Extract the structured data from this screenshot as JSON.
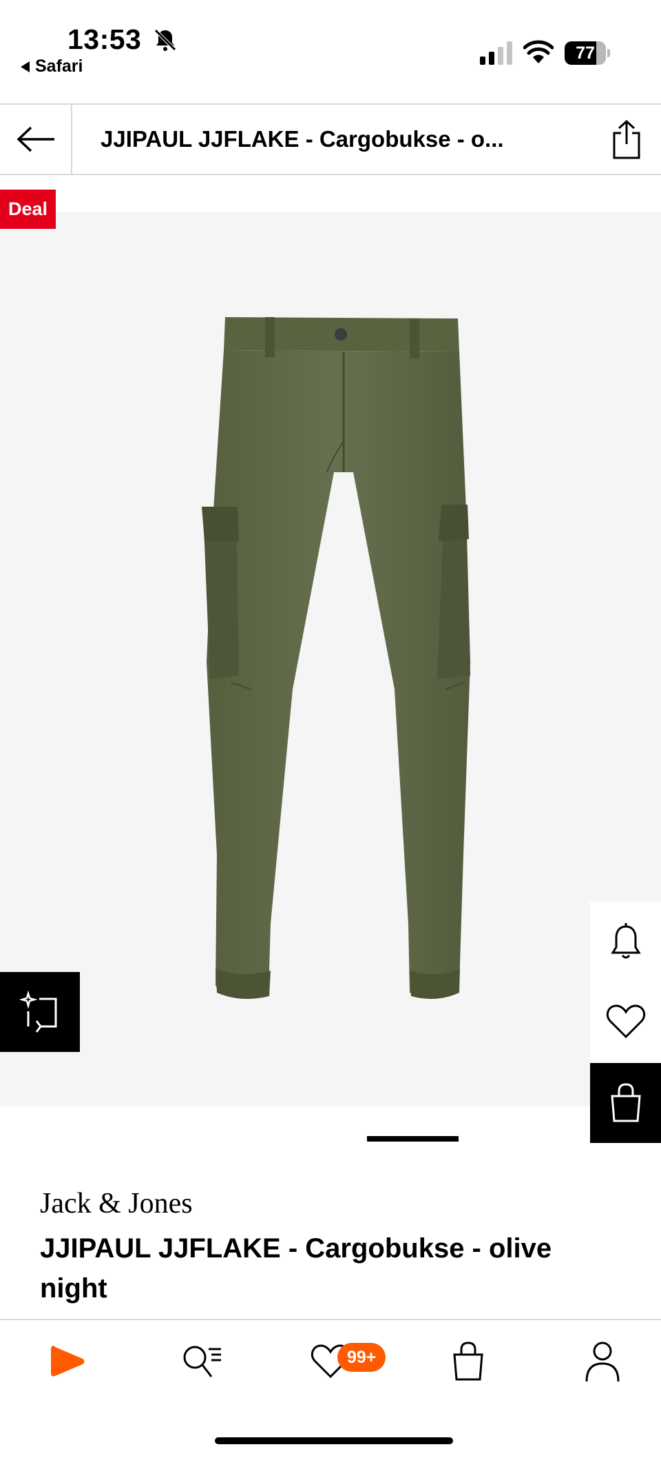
{
  "status_bar": {
    "time": "13:53",
    "back_app": "Safari",
    "battery": "77",
    "battery_level": 0.77
  },
  "header": {
    "title": "JJIPAUL JJFLAKE  - Cargobukse - o..."
  },
  "badge_deal": "Deal",
  "product": {
    "brand": "Jack & Jones",
    "name": "JJIPAUL JJFLAKE  - Cargobukse - olive night",
    "image_color": "#5b6447"
  },
  "tabbar": {
    "wishlist_badge": "99+",
    "accent": "#ff5a00"
  },
  "icons": [
    "bell-off-icon",
    "signal-icon",
    "wifi-icon",
    "battery-icon",
    "arrow-left-icon",
    "share-icon",
    "sparkle-compare-icon",
    "bell-icon",
    "heart-icon",
    "shopping-bag-icon",
    "play-logo-icon",
    "search-list-icon",
    "user-icon"
  ]
}
